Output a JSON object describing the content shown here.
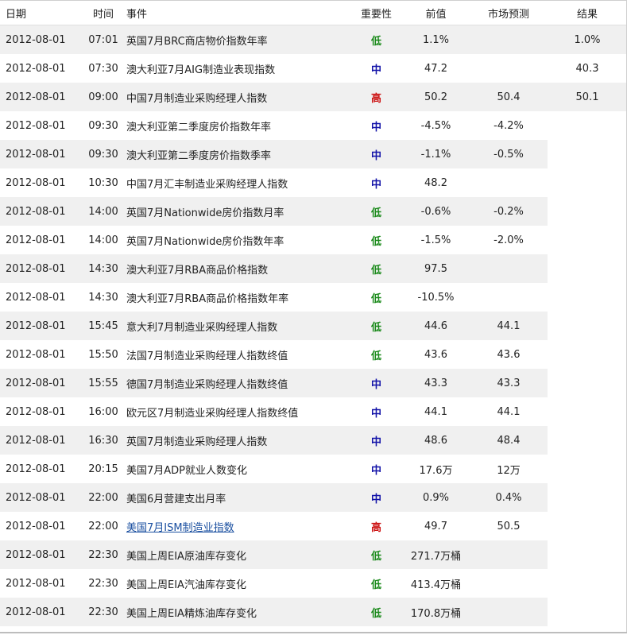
{
  "headers": {
    "date": "日期",
    "time": "时间",
    "event": "事件",
    "importance": "重要性",
    "previous": "前值",
    "forecast": "市场预测",
    "result": "结果"
  },
  "importance_colors": {
    "低": "#1a8a1a",
    "中": "#1212a8",
    "高": "#cc1111"
  },
  "rows": [
    {
      "date": "2012-08-01",
      "time": "07:01",
      "event": "英国7月BRC商店物价指数年率",
      "importance": "低",
      "previous": "1.1%",
      "forecast": "",
      "result": "1.0%"
    },
    {
      "date": "2012-08-01",
      "time": "07:30",
      "event": "澳大利亚7月AIG制造业表现指数",
      "importance": "中",
      "previous": "47.2",
      "forecast": "",
      "result": "40.3"
    },
    {
      "date": "2012-08-01",
      "time": "09:00",
      "event": "中国7月制造业采购经理人指数",
      "importance": "高",
      "previous": "50.2",
      "forecast": "50.4",
      "result": "50.1"
    },
    {
      "date": "2012-08-01",
      "time": "09:30",
      "event": "澳大利亚第二季度房价指数年率",
      "importance": "中",
      "previous": "-4.5%",
      "forecast": "-4.2%",
      "result": ""
    },
    {
      "date": "2012-08-01",
      "time": "09:30",
      "event": "澳大利亚第二季度房价指数季率",
      "importance": "中",
      "previous": "-1.1%",
      "forecast": "-0.5%",
      "result": ""
    },
    {
      "date": "2012-08-01",
      "time": "10:30",
      "event": "中国7月汇丰制造业采购经理人指数",
      "importance": "中",
      "previous": "48.2",
      "forecast": "",
      "result": ""
    },
    {
      "date": "2012-08-01",
      "time": "14:00",
      "event": "英国7月Nationwide房价指数月率",
      "importance": "低",
      "previous": "-0.6%",
      "forecast": "-0.2%",
      "result": ""
    },
    {
      "date": "2012-08-01",
      "time": "14:00",
      "event": "英国7月Nationwide房价指数年率",
      "importance": "低",
      "previous": "-1.5%",
      "forecast": "-2.0%",
      "result": ""
    },
    {
      "date": "2012-08-01",
      "time": "14:30",
      "event": "澳大利亚7月RBA商品价格指数",
      "importance": "低",
      "previous": "97.5",
      "forecast": "",
      "result": ""
    },
    {
      "date": "2012-08-01",
      "time": "14:30",
      "event": "澳大利亚7月RBA商品价格指数年率",
      "importance": "低",
      "previous": "-10.5%",
      "forecast": "",
      "result": ""
    },
    {
      "date": "2012-08-01",
      "time": "15:45",
      "event": "意大利7月制造业采购经理人指数",
      "importance": "低",
      "previous": "44.6",
      "forecast": "44.1",
      "result": ""
    },
    {
      "date": "2012-08-01",
      "time": "15:50",
      "event": "法国7月制造业采购经理人指数终值",
      "importance": "低",
      "previous": "43.6",
      "forecast": "43.6",
      "result": ""
    },
    {
      "date": "2012-08-01",
      "time": "15:55",
      "event": "德国7月制造业采购经理人指数终值",
      "importance": "中",
      "previous": "43.3",
      "forecast": "43.3",
      "result": ""
    },
    {
      "date": "2012-08-01",
      "time": "16:00",
      "event": "欧元区7月制造业采购经理人指数终值",
      "importance": "中",
      "previous": "44.1",
      "forecast": "44.1",
      "result": ""
    },
    {
      "date": "2012-08-01",
      "time": "16:30",
      "event": "英国7月制造业采购经理人指数",
      "importance": "中",
      "previous": "48.6",
      "forecast": "48.4",
      "result": ""
    },
    {
      "date": "2012-08-01",
      "time": "20:15",
      "event": "美国7月ADP就业人数变化",
      "importance": "中",
      "previous": "17.6万",
      "forecast": "12万",
      "result": ""
    },
    {
      "date": "2012-08-01",
      "time": "22:00",
      "event": "美国6月营建支出月率",
      "importance": "中",
      "previous": "0.9%",
      "forecast": "0.4%",
      "result": ""
    },
    {
      "date": "2012-08-01",
      "time": "22:00",
      "event": "美国7月ISM制造业指数",
      "importance": "高",
      "previous": "49.7",
      "forecast": "50.5",
      "result": "",
      "link": true
    },
    {
      "date": "2012-08-01",
      "time": "22:30",
      "event": "美国上周EIA原油库存变化",
      "importance": "低",
      "previous": "271.7万桶",
      "forecast": "",
      "result": ""
    },
    {
      "date": "2012-08-01",
      "time": "22:30",
      "event": "美国上周EIA汽油库存变化",
      "importance": "低",
      "previous": "413.4万桶",
      "forecast": "",
      "result": ""
    },
    {
      "date": "2012-08-01",
      "time": "22:30",
      "event": "美国上周EIA精炼油库存变化",
      "importance": "低",
      "previous": "170.8万桶",
      "forecast": "",
      "result": ""
    }
  ]
}
